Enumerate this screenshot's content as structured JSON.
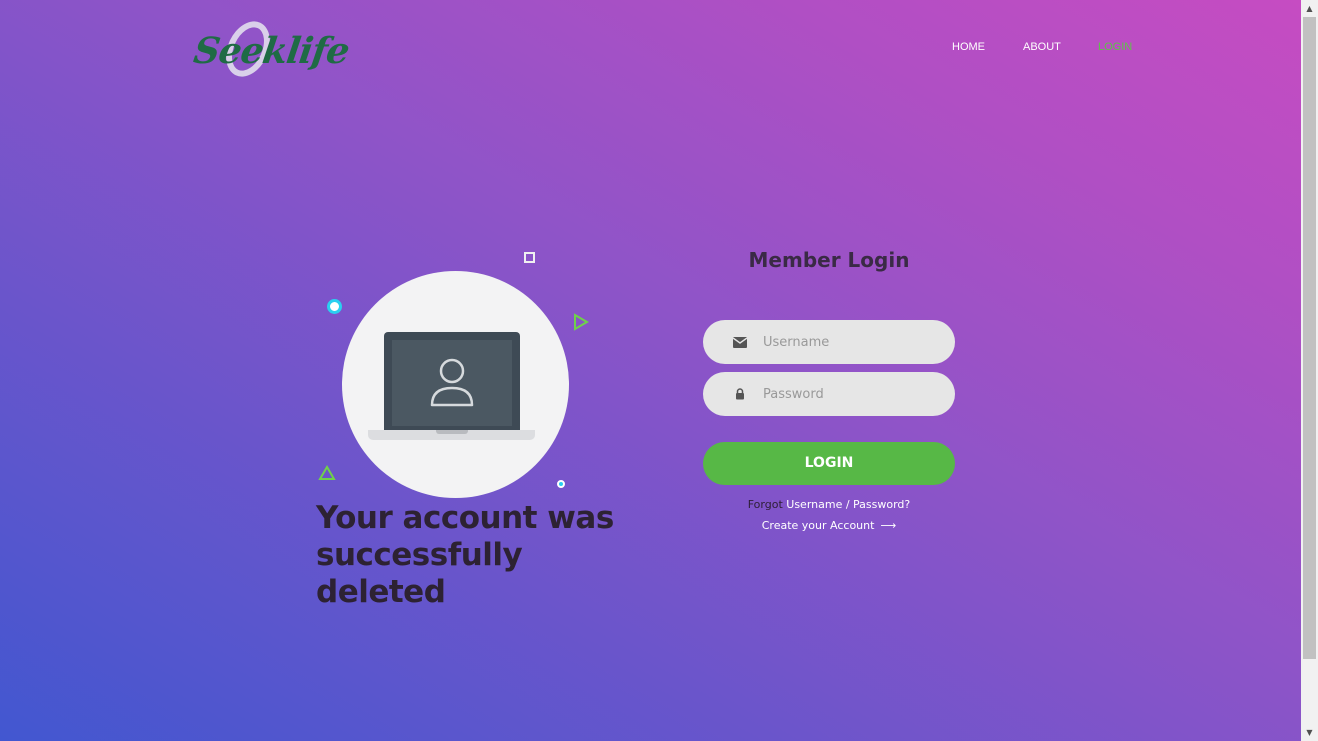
{
  "brand": {
    "logo_text": "Seeklife",
    "colors": {
      "accent_green": "#57b846",
      "nav_active": "#5fc24a",
      "logo_green": "#1f6b45"
    }
  },
  "nav": {
    "items": [
      {
        "label": "HOME",
        "active": false
      },
      {
        "label": "ABOUT",
        "active": false
      },
      {
        "label": "LOGIN",
        "active": true
      }
    ]
  },
  "illustration": {
    "icon": "laptop-user-icon"
  },
  "message": "Your account was successfully deleted",
  "login_form": {
    "title": "Member Login",
    "username_placeholder": "Username",
    "password_placeholder": "Password",
    "submit_label": "LOGIN",
    "forgot_prefix": "Forgot",
    "forgot_link": "Username / Password?",
    "create_account": "Create your Account"
  }
}
